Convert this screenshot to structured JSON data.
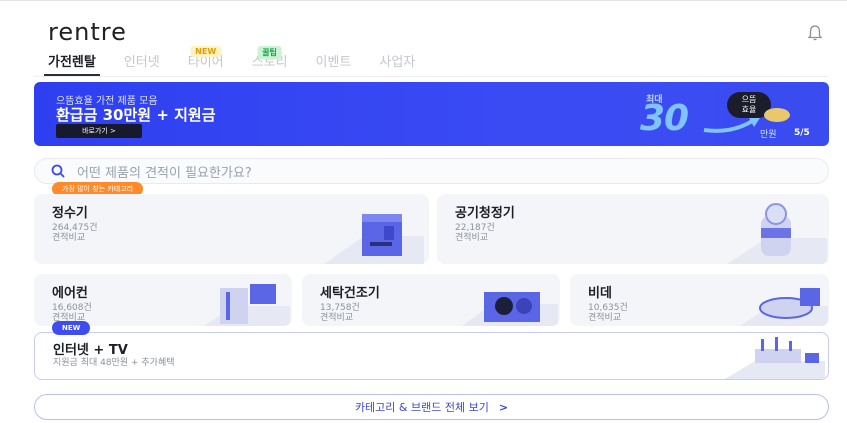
{
  "header": {
    "logo": "rentre",
    "bell_icon": "bell-icon"
  },
  "tabs": [
    {
      "label": "가전렌탈",
      "badge": ""
    },
    {
      "label": "인터넷",
      "badge": ""
    },
    {
      "label": "타이어",
      "badge": "NEW"
    },
    {
      "label": "스토리",
      "badge": "꿀팁"
    },
    {
      "label": "이벤트",
      "badge": ""
    },
    {
      "label": "사업자",
      "badge": ""
    }
  ],
  "banner": {
    "subtitle": "으뜸효율 가전 제품 모음",
    "title": "환급금 30만원 + 지원금",
    "button": "바로가기 >",
    "best": "최대",
    "big": "30",
    "unit": "만원",
    "bubble_line1": "으뜸",
    "bubble_line2": "효율",
    "page": "5/5"
  },
  "search": {
    "placeholder": "어떤 제품의 견적이 필요한가요?"
  },
  "category_badge": "가장 많이 찾는 카테고리",
  "categories": [
    {
      "title": "정수기",
      "count": "264,475건",
      "sub": "견적비교"
    },
    {
      "title": "공기청정기",
      "count": "22,187건",
      "sub": "견적비교"
    },
    {
      "title": "에어컨",
      "count": "16,608건",
      "sub": "견적비교"
    },
    {
      "title": "세탁건조기",
      "count": "13,758건",
      "sub": "견적비교"
    },
    {
      "title": "비데",
      "count": "10,635건",
      "sub": "견적비교"
    }
  ],
  "internet": {
    "badge": "NEW",
    "title": "인터넷 + TV",
    "sub": "지원금 최대 48만원 + 추가혜택"
  },
  "all_button": {
    "label": "카테고리 & 브랜드 전체 보기",
    "chevron": ">"
  },
  "colors": {
    "accent": "#3a4bf4",
    "orange": "#ff8a2b",
    "card_bg": "#f4f5f8"
  }
}
